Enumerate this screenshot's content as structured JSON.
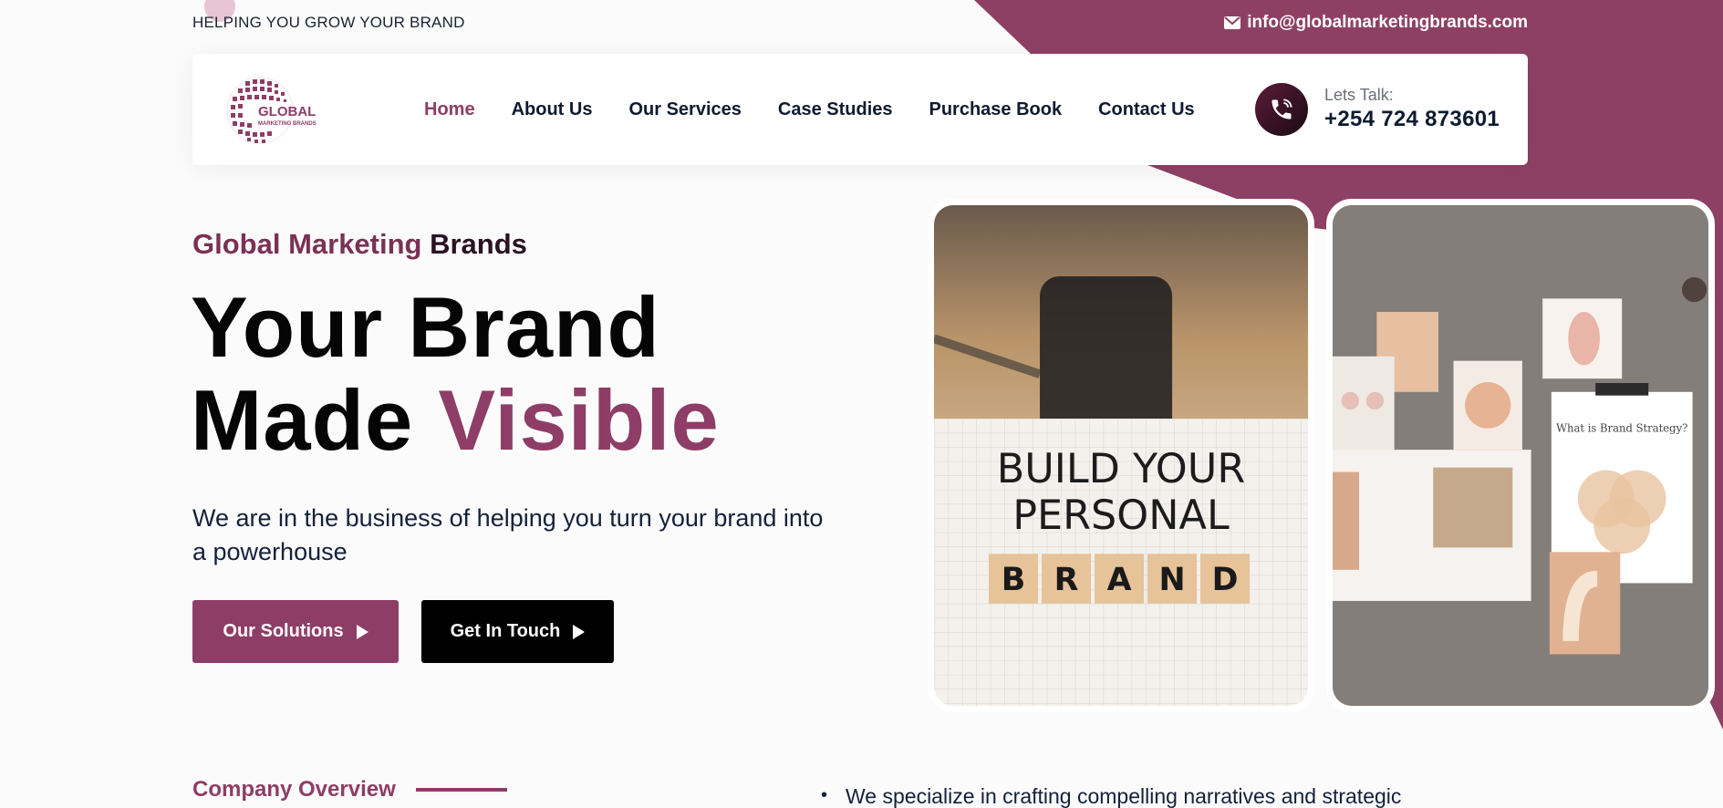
{
  "topbar": {
    "tagline": "HELPING YOU GROW YOUR BRAND",
    "email": "info@globalmarketingbrands.com",
    "email_icon": "envelope-icon"
  },
  "header": {
    "logo": {
      "line1": "GLOBAL",
      "line2": "MARKETING BRANDS"
    },
    "nav": [
      {
        "label": "Home",
        "active": true
      },
      {
        "label": "About Us"
      },
      {
        "label": "Our Services"
      },
      {
        "label": "Case Studies"
      },
      {
        "label": "Purchase Book"
      },
      {
        "label": "Contact Us"
      }
    ],
    "phone_icon": "phone-icon",
    "phone_label": "Lets Talk:",
    "phone_number": "+254 724 873601"
  },
  "hero": {
    "kicker_accent": "Global Marketing",
    "kicker_rest": " Brands",
    "title_line1": "Your Brand",
    "title_line2_plain": "Made ",
    "title_line2_highlight": "Visible",
    "subtitle": "We are in the business of helping you turn your brand into a powerhouse",
    "btn_solutions": "Our Solutions",
    "btn_touch": "Get In Touch"
  },
  "photos": {
    "photo1_line1": "BUILD YOUR",
    "photo1_line2": "PERSONAL",
    "photo1_tiles": [
      "B",
      "R",
      "A",
      "N",
      "D"
    ],
    "photo2_card": "What is Brand Strategy?"
  },
  "overview": {
    "title": "Company Overview",
    "bullet": "We specialize in crafting compelling narratives and strategic"
  },
  "colors": {
    "brand": "#8e3d66",
    "dark": "#0e1a2e",
    "band": "#8e4064"
  }
}
